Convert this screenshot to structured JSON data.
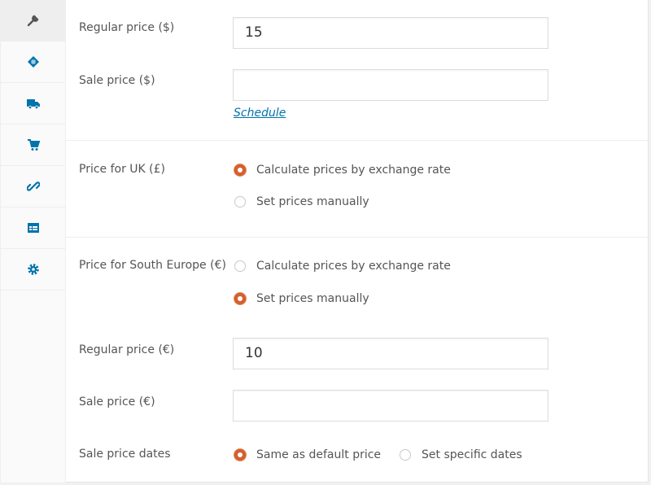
{
  "sidebar": {
    "tabs": [
      {
        "icon": "wrench-icon",
        "active": true
      },
      {
        "icon": "tag-icon",
        "active": false
      },
      {
        "icon": "truck-icon",
        "active": false
      },
      {
        "icon": "cart-icon",
        "active": false
      },
      {
        "icon": "link-icon",
        "active": false
      },
      {
        "icon": "list-icon",
        "active": false
      },
      {
        "icon": "gear-icon",
        "active": false
      }
    ],
    "accent": "#0073aa"
  },
  "default_price": {
    "regular_label": "Regular price ($)",
    "regular_value": "15",
    "sale_label": "Sale price ($)",
    "sale_value": "",
    "schedule_link": "Schedule"
  },
  "uk": {
    "label": "Price for UK (£)",
    "options": [
      "Calculate prices by exchange rate",
      "Set prices manually"
    ],
    "selected": 0
  },
  "south_europe": {
    "label": "Price for South Europe (€)",
    "options": [
      "Calculate prices by exchange rate",
      "Set prices manually"
    ],
    "selected": 1,
    "regular_label": "Regular price (€)",
    "regular_value": "10",
    "sale_label": "Sale price (€)",
    "sale_value": "",
    "dates_label": "Sale price dates",
    "dates_options": [
      "Same as default price",
      "Set specific dates"
    ],
    "dates_selected": 0
  },
  "colors": {
    "radio_selected": "#d4602f",
    "link": "#0073aa"
  }
}
